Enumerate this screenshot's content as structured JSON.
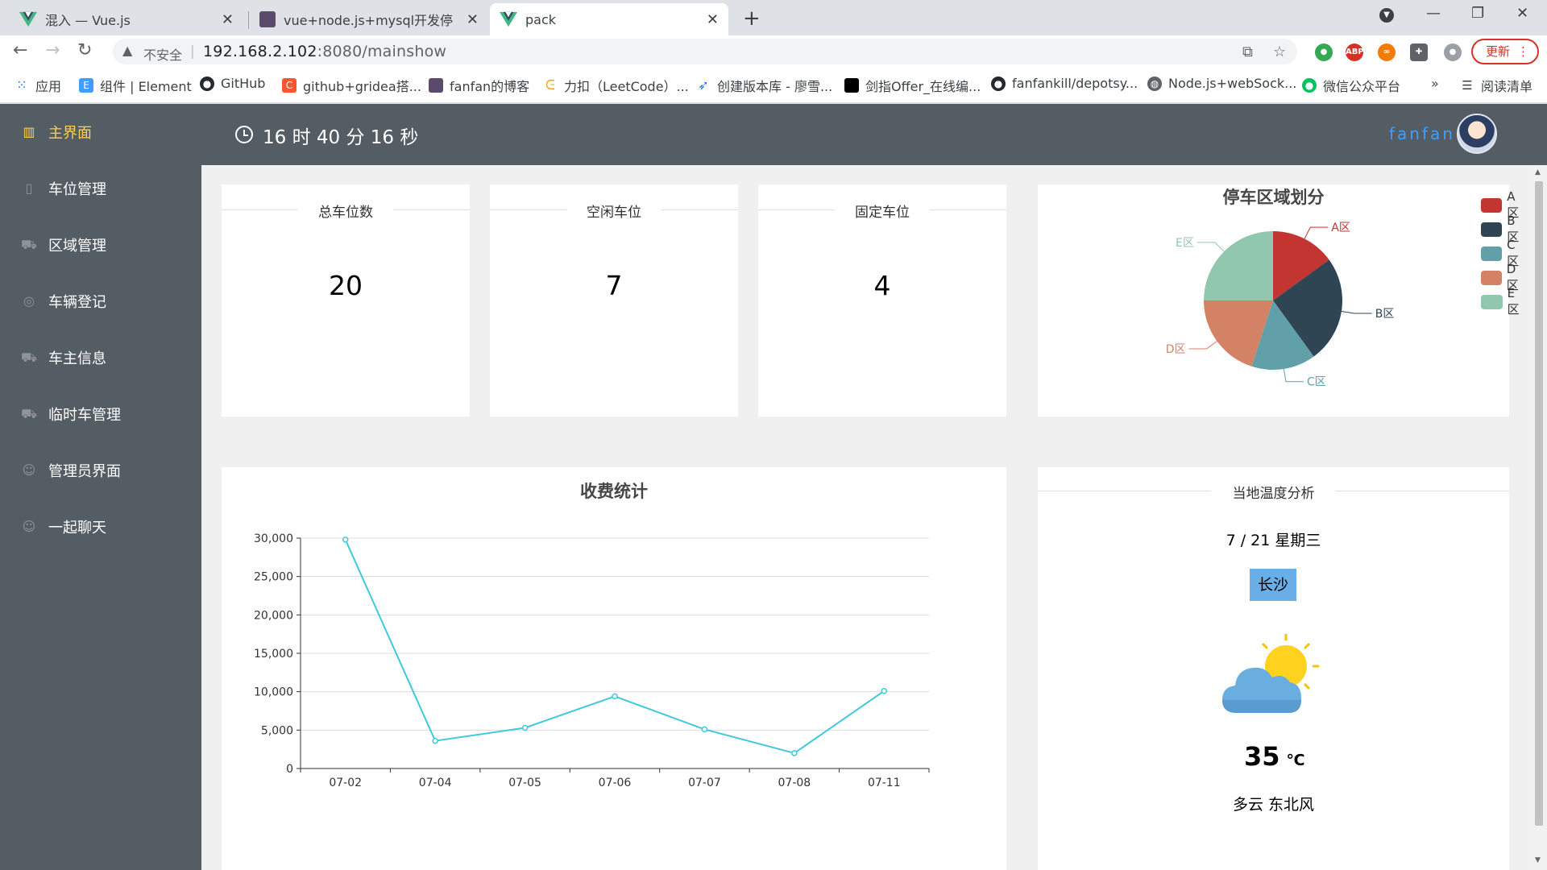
{
  "browser": {
    "tabs": [
      {
        "title": "混入 — Vue.js",
        "active": false
      },
      {
        "title": "vue+node.js+mysql开发停车场",
        "active": false
      },
      {
        "title": "pack",
        "active": true
      }
    ],
    "address": {
      "security_label": "不安全",
      "host": "192.168.2.102",
      "path": ":8080/mainshow"
    },
    "update_label": "更新",
    "bookmarks": [
      "应用",
      "组件 | Element",
      "GitHub",
      "github+gridea搭...",
      "fanfan的博客",
      "力扣（LeetCode）...",
      "创建版本库 - 廖雪...",
      "剑指Offer_在线编...",
      "fanfankill/depotsy...",
      "Node.js+webSock...",
      "微信公众平台"
    ],
    "bookmarks_more": "»",
    "reading_list": "阅读清单"
  },
  "sidebar": {
    "items": [
      {
        "label": "主界面",
        "icon": "bar-chart-icon",
        "active": true
      },
      {
        "label": "车位管理",
        "icon": "parking-icon",
        "active": false
      },
      {
        "label": "区域管理",
        "icon": "car-icon",
        "active": false
      },
      {
        "label": "车辆登记",
        "icon": "circle-icon",
        "active": false
      },
      {
        "label": "车主信息",
        "icon": "car-icon",
        "active": false
      },
      {
        "label": "临时车管理",
        "icon": "car-icon",
        "active": false
      },
      {
        "label": "管理员界面",
        "icon": "user-icon",
        "active": false
      },
      {
        "label": "一起聊天",
        "icon": "user-icon",
        "active": false
      }
    ]
  },
  "header": {
    "time": "16 时 40 分 16 秒",
    "username": "fanfan"
  },
  "stats": [
    {
      "label": "总车位数",
      "value": "20"
    },
    {
      "label": "空闲车位",
      "value": "7"
    },
    {
      "label": "固定车位",
      "value": "4"
    }
  ],
  "weather": {
    "title": "当地温度分析",
    "date": "7 / 21 星期三",
    "city": "长沙",
    "temperature": "35",
    "unit": "℃",
    "description": "多云 东北风"
  },
  "colors": {
    "accent": "#409eff",
    "sidebar_bg": "#545c64",
    "active_menu": "#ffd04b",
    "line": "#3fc9dd"
  },
  "chart_data": [
    {
      "type": "pie",
      "title": "停车区域划分",
      "categories": [
        "A区",
        "B区",
        "C区",
        "D区",
        "E区"
      ],
      "values": [
        3,
        5,
        3,
        4,
        5
      ],
      "colors": [
        "#c23531",
        "#2f4554",
        "#61a0a8",
        "#d48265",
        "#91c7ae"
      ],
      "legend": "top-right"
    },
    {
      "type": "line",
      "title": "收费统计",
      "categories": [
        "07-02",
        "07-04",
        "07-05",
        "07-06",
        "07-07",
        "07-08",
        "07-11"
      ],
      "series": [
        {
          "values": [
            29800,
            3600,
            5300,
            9400,
            5100,
            2000,
            10100
          ]
        }
      ],
      "ylim": [
        0,
        30000
      ],
      "yticks": [
        "0",
        "5,000",
        "10,000",
        "15,000",
        "20,000",
        "25,000",
        "30,000"
      ],
      "grid": true
    }
  ]
}
